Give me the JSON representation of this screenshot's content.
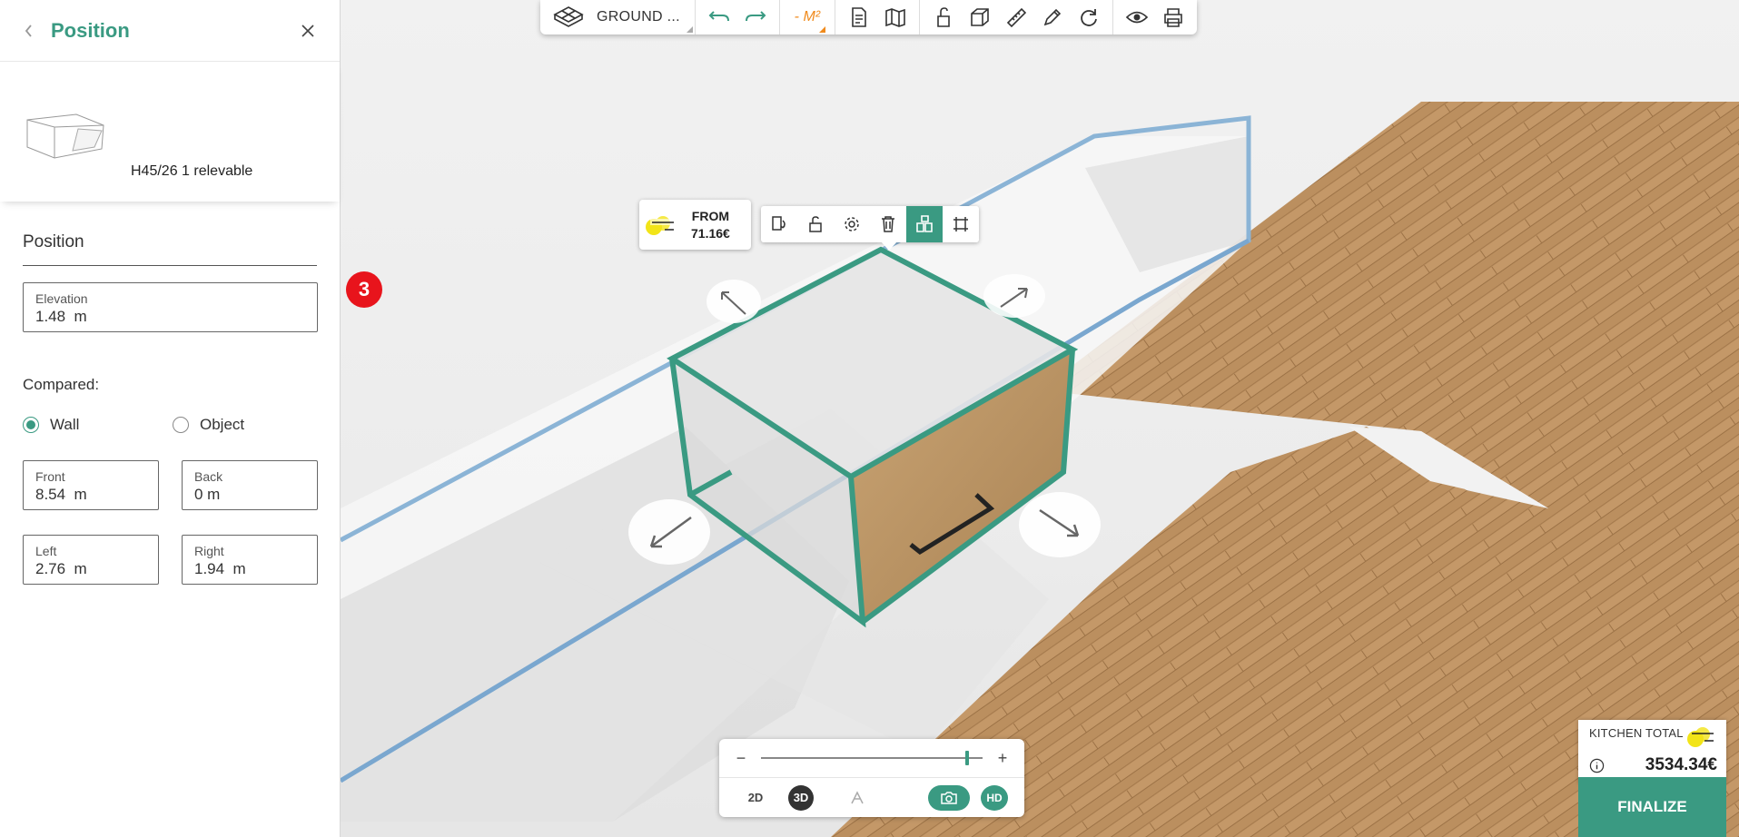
{
  "panel": {
    "title": "Position",
    "product_name": "H45/26 1 relevable",
    "section_title": "Position",
    "elevation": {
      "label": "Elevation",
      "value": "1.48  m"
    },
    "step_badge": "3",
    "compared_label": "Compared:",
    "radio_wall": "Wall",
    "radio_object": "Object",
    "selected_reference": "Wall",
    "front": {
      "label": "Front",
      "value": "8.54  m"
    },
    "back": {
      "label": "Back",
      "value": "0 m"
    },
    "left": {
      "label": "Left",
      "value": "2.76  m"
    },
    "right": {
      "label": "Right",
      "value": "1.94  m"
    }
  },
  "toolbar": {
    "floor_label": "GROUND ...",
    "m2_label": "- M²",
    "icons": [
      "floor-plan-icon",
      "undo-icon",
      "redo-icon",
      "area-icon",
      "document-icon",
      "map-icon",
      "lock-icon",
      "cube-icon",
      "ruler-icon",
      "pen-icon",
      "rotate-icon",
      "eye-icon",
      "print-icon"
    ]
  },
  "context": {
    "price_from": "FROM",
    "price_value": "71.16€",
    "icons": [
      "replace-icon",
      "unlock-icon",
      "gear-icon",
      "trash-icon",
      "blocks-icon",
      "frame-icon"
    ],
    "active_icon": "blocks-icon"
  },
  "view": {
    "zoom_minus": "−",
    "zoom_plus": "+",
    "zoom_level": 0.93,
    "mode_2d": "2D",
    "mode_3d": "3D",
    "active_mode": "3D",
    "hd_label": "HD"
  },
  "summary": {
    "kitchen_total_label": "KITCHEN TOTAL",
    "total": "3534.34€",
    "finalize_label": "FINALIZE"
  },
  "colors": {
    "accent": "#3a9a82",
    "highlight": "#e8141c",
    "selection_outline": "#3a9a82",
    "wall_outline": "#8bb4d6",
    "floor_wood": "#b88a5a"
  }
}
